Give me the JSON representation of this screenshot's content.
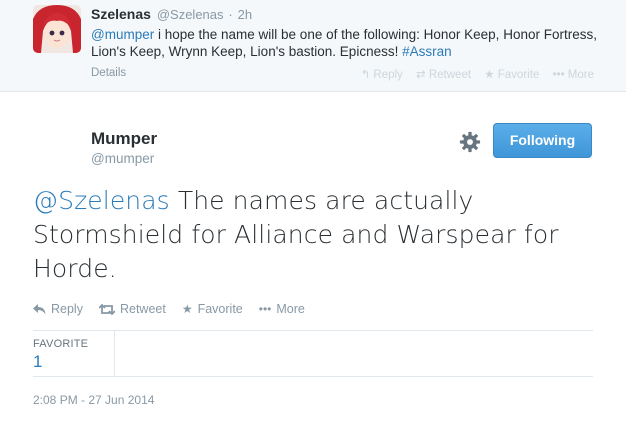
{
  "context_tweet": {
    "fullname": "Szelenas",
    "username": "@Szelenas",
    "dot": "·",
    "time": "2h",
    "mention": "@mumper",
    "text": " i hope the name will be one of the following: Honor Keep, Honor Fortress, Lion's Keep, Wrynn Keep, Lion's bastion. Epicness! ",
    "hashtag": "#Assran",
    "details_label": "Details",
    "actions": [
      "Reply",
      "Retweet",
      "Favorite",
      "More"
    ]
  },
  "tweet": {
    "author_name": "Mumper",
    "author_handle": "@mumper",
    "follow_button_label": "Following",
    "mention": "@Szelenas",
    "text": " The names are actually Stormshield for Alliance and Warspear for Horde.",
    "actions": {
      "reply": "Reply",
      "retweet": "Retweet",
      "favorite": "Favorite",
      "more": "More"
    },
    "stats": {
      "favorite_label": "FAVORITE",
      "favorite_count": "1"
    },
    "timestamp": "2:08 PM - 27 Jun 2014"
  },
  "colors": {
    "link": "#2b7bb9",
    "button": "#4aa3df",
    "muted": "#8899a6"
  }
}
